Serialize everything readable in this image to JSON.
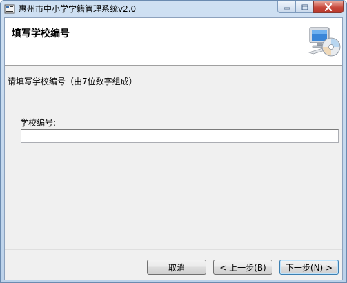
{
  "window": {
    "title": "惠州市中小学学籍管理系统v2.0"
  },
  "header": {
    "title": "填写学校编号"
  },
  "body": {
    "instruction": "请填写学校编号（由7位数字组成）",
    "school_code_label": "学校编号:",
    "school_code_value": ""
  },
  "footer": {
    "cancel_label": "取消",
    "back_label": "< 上一步(B)",
    "next_label": "下一步(N) >"
  },
  "colors": {
    "title_bar": "#cfe0f2",
    "close_button": "#c7473a",
    "panel_background": "#f0f0f0",
    "default_button_border": "#3c7fb1"
  },
  "icons": {
    "app": "school-app-icon",
    "header": "computer-cd-icon"
  }
}
